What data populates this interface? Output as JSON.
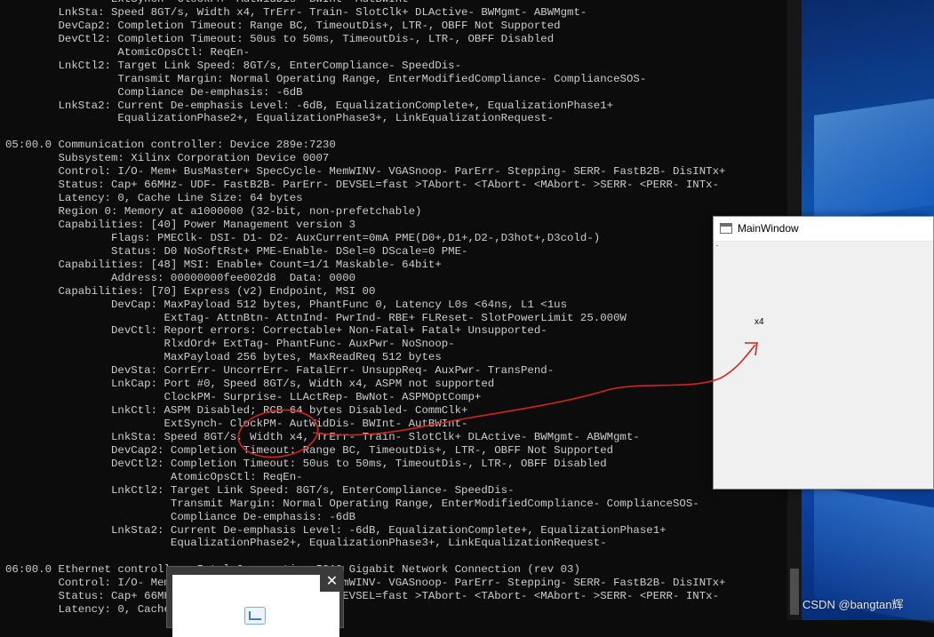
{
  "terminal": {
    "lines": [
      "                ExtSynch- ClockPM- AutWidDis- BWInt- AutBWInt-",
      "        LnkSta: Speed 8GT/s, Width x4, TrErr- Train- SlotClk+ DLActive- BWMgmt- ABWMgmt-",
      "        DevCap2: Completion Timeout: Range BC, TimeoutDis+, LTR-, OBFF Not Supported",
      "        DevCtl2: Completion Timeout: 50us to 50ms, TimeoutDis-, LTR-, OBFF Disabled",
      "                 AtomicOpsCtl: ReqEn-",
      "        LnkCtl2: Target Link Speed: 8GT/s, EnterCompliance- SpeedDis-",
      "                 Transmit Margin: Normal Operating Range, EnterModifiedCompliance- ComplianceSOS-",
      "                 Compliance De-emphasis: -6dB",
      "        LnkSta2: Current De-emphasis Level: -6dB, EqualizationComplete+, EqualizationPhase1+",
      "                 EqualizationPhase2+, EqualizationPhase3+, LinkEqualizationRequest-",
      "",
      "05:00.0 Communication controller: Device 289e:7230",
      "        Subsystem: Xilinx Corporation Device 0007",
      "        Control: I/O- Mem+ BusMaster+ SpecCycle- MemWINV- VGASnoop- ParErr- Stepping- SERR- FastB2B- DisINTx+",
      "        Status: Cap+ 66MHz- UDF- FastB2B- ParErr- DEVSEL=fast >TAbort- <TAbort- <MAbort- >SERR- <PERR- INTx-",
      "        Latency: 0, Cache Line Size: 64 bytes",
      "        Region 0: Memory at a1000000 (32-bit, non-prefetchable)",
      "        Capabilities: [40] Power Management version 3",
      "                Flags: PMEClk- DSI- D1- D2- AuxCurrent=0mA PME(D0+,D1+,D2-,D3hot+,D3cold-)",
      "                Status: D0 NoSoftRst+ PME-Enable- DSel=0 DScale=0 PME-",
      "        Capabilities: [48] MSI: Enable+ Count=1/1 Maskable- 64bit+",
      "                Address: 00000000fee002d8  Data: 0000",
      "        Capabilities: [70] Express (v2) Endpoint, MSI 00",
      "                DevCap: MaxPayload 512 bytes, PhantFunc 0, Latency L0s <64ns, L1 <1us",
      "                        ExtTag- AttnBtn- AttnInd- PwrInd- RBE+ FLReset- SlotPowerLimit 25.000W",
      "                DevCtl: Report errors: Correctable+ Non-Fatal+ Fatal+ Unsupported-",
      "                        RlxdOrd+ ExtTag- PhantFunc- AuxPwr- NoSnoop-",
      "                        MaxPayload 256 bytes, MaxReadReq 512 bytes",
      "                DevSta: CorrErr- UncorrErr- FatalErr- UnsuppReq- AuxPwr- TransPend-",
      "                LnkCap: Port #0, Speed 8GT/s, Width x4, ASPM not supported",
      "                        ClockPM- Surprise- LLActRep- BwNot- ASPMOptComp+",
      "                LnkCtl: ASPM Disabled; RCB 64 bytes Disabled- CommClk+",
      "                        ExtSynch- ClockPM- AutWidDis- BWInt- AutBWInt-",
      "                LnkSta: Speed 8GT/s, Width x4, TrErr- Train- SlotClk+ DLActive- BWMgmt- ABWMgmt-",
      "                DevCap2: Completion Timeout: Range BC, TimeoutDis+, LTR-, OBFF Not Supported",
      "                DevCtl2: Completion Timeout: 50us to 50ms, TimeoutDis-, LTR-, OBFF Disabled",
      "                         AtomicOpsCtl: ReqEn-",
      "                LnkCtl2: Target Link Speed: 8GT/s, EnterCompliance- SpeedDis-",
      "                         Transmit Margin: Normal Operating Range, EnterModifiedCompliance- ComplianceSOS-",
      "                         Compliance De-emphasis: -6dB",
      "                LnkSta2: Current De-emphasis Level: -6dB, EqualizationComplete+, EqualizationPhase1+",
      "                         EqualizationPhase2+, EqualizationPhase3+, LinkEqualizationRequest-",
      "",
      "06:00.0 Ethernet controller: Intel Corporation I210 Gigabit Network Connection (rev 03)",
      "        Control: I/O- Mem+ BusMaster+ SpecCycle- MemWINV- VGASnoop- ParErr- Stepping- SERR- FastB2B- DisINTx+",
      "        Status: Cap+ 66MHz- UDF- FastB2B- ParErr- DEVSEL=fast >TAbort- <TAbort- <MAbort- >SERR- <PERR- INTx-",
      "        Latency: 0, Cache Line Size: 64 bytes"
    ]
  },
  "main_window": {
    "title": "MainWindow",
    "label": "x4",
    "icon": "window-icon"
  },
  "popup": {
    "close_label": "✕",
    "icon": "chart-icon"
  },
  "watermark": "CSDN @bangtan辉",
  "colors": {
    "terminal_bg": "#0c0c0c",
    "terminal_fg": "#cccccc",
    "annotation": "#d0261b",
    "window_bg": "#f0f0f0"
  }
}
